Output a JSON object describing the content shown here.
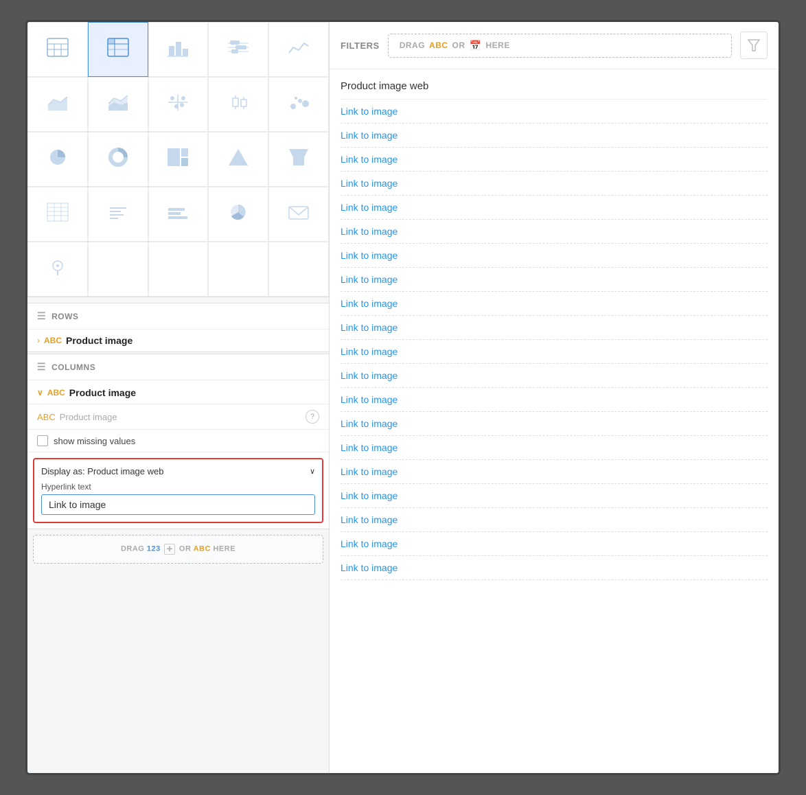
{
  "leftPanel": {
    "chartGrid": [
      {
        "id": "table",
        "icon": "⊞",
        "active": false
      },
      {
        "id": "pivot",
        "icon": "⊟",
        "active": true
      },
      {
        "id": "bar",
        "icon": "▊",
        "active": false
      },
      {
        "id": "gantt",
        "icon": "≡",
        "active": false
      },
      {
        "id": "line",
        "icon": "∿",
        "active": false
      },
      {
        "id": "area",
        "icon": "▲",
        "active": false
      },
      {
        "id": "area2",
        "icon": "▵",
        "active": false
      },
      {
        "id": "cross",
        "icon": "✕",
        "active": false
      },
      {
        "id": "box",
        "icon": "◪",
        "active": false
      },
      {
        "id": "scatter",
        "icon": "⁘",
        "active": false
      },
      {
        "id": "pie",
        "icon": "◑",
        "active": false
      },
      {
        "id": "donut",
        "icon": "○",
        "active": false
      },
      {
        "id": "treemap",
        "icon": "▦",
        "active": false
      },
      {
        "id": "pyramid",
        "icon": "△",
        "active": false
      },
      {
        "id": "funnel",
        "icon": "▽",
        "active": false
      },
      {
        "id": "grid",
        "icon": "▤",
        "active": false
      },
      {
        "id": "text-table",
        "icon": "≡",
        "active": false
      },
      {
        "id": "bar2",
        "icon": "▌",
        "active": false
      },
      {
        "id": "pie2",
        "icon": "◍",
        "active": false
      },
      {
        "id": "envelope",
        "icon": "⊟",
        "active": false
      },
      {
        "id": "map",
        "icon": "📍",
        "active": false
      },
      {
        "id": "empty1",
        "icon": "",
        "active": false
      },
      {
        "id": "empty2",
        "icon": "",
        "active": false
      },
      {
        "id": "empty3",
        "icon": "",
        "active": false
      },
      {
        "id": "empty4",
        "icon": "",
        "active": false
      }
    ],
    "rows": {
      "label": "ROWS",
      "field": {
        "abc": "ABC",
        "name": "Product image"
      }
    },
    "columns": {
      "label": "COLUMNS",
      "expanded": {
        "abc": "ABC",
        "name": "Product image",
        "fieldAbc": "ABC",
        "fieldName": "Product image",
        "showMissingValues": "show missing values"
      },
      "displayAs": {
        "label": "Display as: Product image web",
        "hyperlinkLabel": "Hyperlink text",
        "hyperlinkValue": "Link to image"
      }
    },
    "dragBottom": {
      "drag": "DRAG",
      "num": "123",
      "or": ",",
      "abc": "ABC",
      "here": "HERE"
    }
  },
  "rightPanel": {
    "filters": {
      "label": "FILTERS",
      "drag": "DRAG",
      "abc": "ABC",
      "or": "OR",
      "here": "HERE"
    },
    "resultHeader": "Product image web",
    "links": [
      "Link to image",
      "Link to image",
      "Link to image",
      "Link to image",
      "Link to image",
      "Link to image",
      "Link to image",
      "Link to image",
      "Link to image",
      "Link to image",
      "Link to image",
      "Link to image",
      "Link to image",
      "Link to image",
      "Link to image",
      "Link to image",
      "Link to image",
      "Link to image",
      "Link to image",
      "Link to image"
    ]
  }
}
